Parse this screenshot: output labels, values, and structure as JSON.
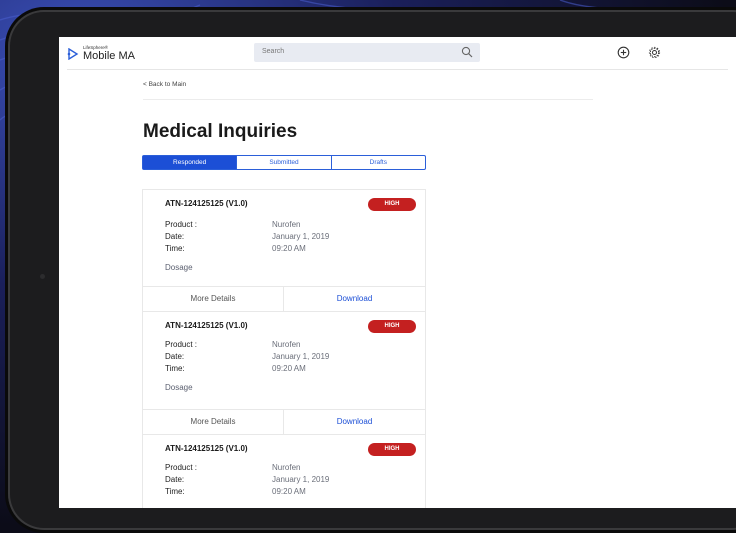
{
  "header": {
    "logo_small": "LifeSphere®",
    "logo_big": "Mobile MA",
    "search_placeholder": "Search"
  },
  "nav": {
    "back_label": "< Back to Main"
  },
  "page": {
    "title": "Medical Inquiries"
  },
  "tabs": [
    {
      "label": "Responded",
      "active": true
    },
    {
      "label": "Submitted",
      "active": false
    },
    {
      "label": "Drafts",
      "active": false
    }
  ],
  "labels": {
    "product": "Product :",
    "date": "Date:",
    "time": "Time:"
  },
  "cards": [
    {
      "id": "ATN-124125125 (V1.0)",
      "priority": "HIGH",
      "product": "Nurofen",
      "date": "January 1, 2019",
      "time": "09:20 AM",
      "topic": "Dosage",
      "more": "More Details",
      "download": "Download"
    },
    {
      "id": "ATN-124125125 (V1.0)",
      "priority": "HIGH",
      "product": "Nurofen",
      "date": "January 1, 2019",
      "time": "09:20 AM",
      "topic": "Dosage",
      "more": "More Details",
      "download": "Download"
    },
    {
      "id": "ATN-124125125 (V1.0)",
      "priority": "HIGH",
      "product": "Nurofen",
      "date": "January 1, 2019",
      "time": "09:20 AM"
    }
  ],
  "colors": {
    "accent": "#1c4fd6",
    "badge": "#c42020"
  }
}
